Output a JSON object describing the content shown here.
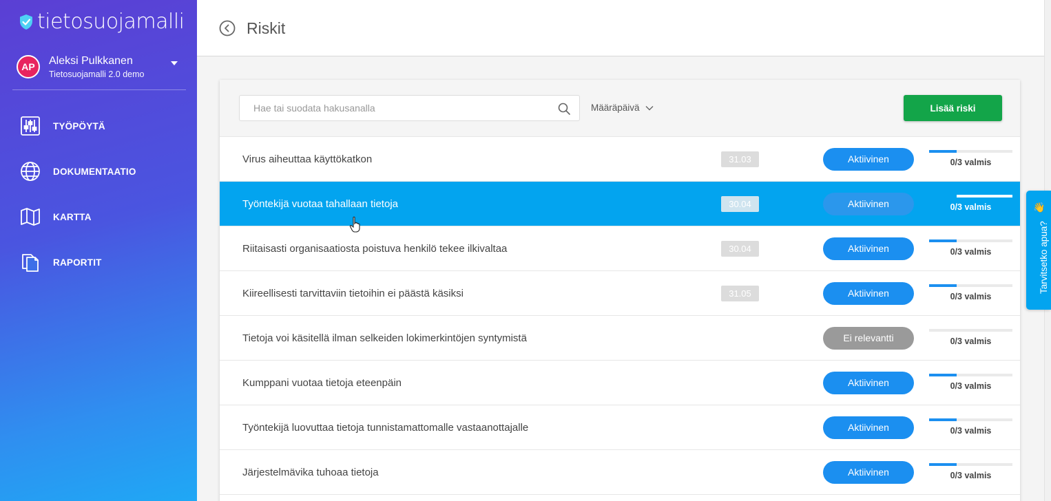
{
  "app": {
    "logo_text": "tietosuojamalli"
  },
  "user": {
    "initials": "AP",
    "name": "Aleksi Pulkkanen",
    "org": "Tietosuojamalli 2.0 demo"
  },
  "nav": [
    {
      "label": "TYÖPÖYTÄ",
      "icon": "dashboard-sliders-icon"
    },
    {
      "label": "DOKUMENTAATIO",
      "icon": "globe-icon"
    },
    {
      "label": "KARTTA",
      "icon": "map-icon"
    },
    {
      "label": "RAPORTIT",
      "icon": "reports-icon"
    }
  ],
  "header": {
    "title": "Riskit"
  },
  "toolbar": {
    "search_placeholder": "Hae tai suodata hakusanalla",
    "sort_label": "Määräpäivä",
    "add_button": "Lisää riski"
  },
  "risks": [
    {
      "title": "Virus aiheuttaa käyttökatkon",
      "date": "31.03",
      "status": "Aktiivinen",
      "progress": 0.33,
      "progress_label": "0/3 valmis"
    },
    {
      "title": "Työntekijä vuotaa tahallaan tietoja",
      "date": "30.04",
      "status": "Aktiivinen",
      "progress": 0.33,
      "progress_label": "0/3 valmis",
      "selected": true
    },
    {
      "title": "Riitaisasti organisaatiosta poistuva henkilö tekee ilkivaltaa",
      "date": "30.04",
      "status": "Aktiivinen",
      "progress": 0.33,
      "progress_label": "0/3 valmis"
    },
    {
      "title": "Kiireellisesti tarvittaviin tietoihin ei päästä käsiksi",
      "date": "31.05",
      "status": "Aktiivinen",
      "progress": 0.33,
      "progress_label": "0/3 valmis"
    },
    {
      "title": "Tietoja voi käsitellä ilman selkeiden lokimerkintöjen syntymistä",
      "date": "",
      "status": "Ei relevantti",
      "progress": 0,
      "progress_label": "0/3 valmis"
    },
    {
      "title": "Kumppani vuotaa tietoja eteenpäin",
      "date": "",
      "status": "Aktiivinen",
      "progress": 0.33,
      "progress_label": "0/3 valmis"
    },
    {
      "title": "Työntekijä luovuttaa tietoja tunnistamattomalle vastaanottajalle",
      "date": "",
      "status": "Aktiivinen",
      "progress": 0.33,
      "progress_label": "0/3 valmis"
    },
    {
      "title": "Järjestelmävika tuhoaa tietoja",
      "date": "",
      "status": "Aktiivinen",
      "progress": 0.33,
      "progress_label": "0/3 valmis"
    }
  ],
  "help_tab": {
    "label": "Tarvitsetko apua?",
    "emoji": "👋"
  },
  "colors": {
    "accent": "#03a4ef",
    "primary_button": "#13a549",
    "status_active": "#1b8ff0",
    "status_inactive": "#9a9a9a"
  }
}
